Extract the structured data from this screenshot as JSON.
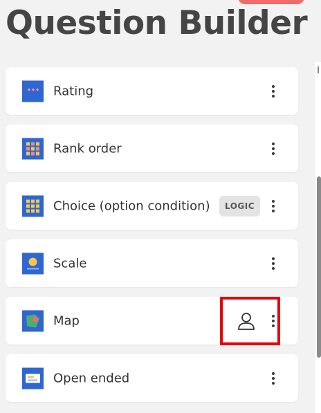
{
  "page": {
    "title": "Question Builder"
  },
  "questions": [
    {
      "label": "Rating",
      "icon": "rating-hearts-icon",
      "icon_bg": "#2f66d0"
    },
    {
      "label": "Rank order",
      "icon": "rank-order-grid-icon",
      "icon_bg": "#2f66d0"
    },
    {
      "label": "Choice (option condition)",
      "icon": "choice-grid-icon",
      "icon_bg": "#2f66d0",
      "badge": "LOGIC"
    },
    {
      "label": "Scale",
      "icon": "scale-icon",
      "icon_bg": "#2f66d0"
    },
    {
      "label": "Map",
      "icon": "map-icon",
      "icon_bg": "#2f66d0"
    },
    {
      "label": "Open ended",
      "icon": "open-ended-icon",
      "icon_bg": "#2f66d0"
    }
  ],
  "colors": {
    "highlight": "#e8000b",
    "top_badge": "#f26b6b",
    "icon_accent": "#f5c84c"
  }
}
